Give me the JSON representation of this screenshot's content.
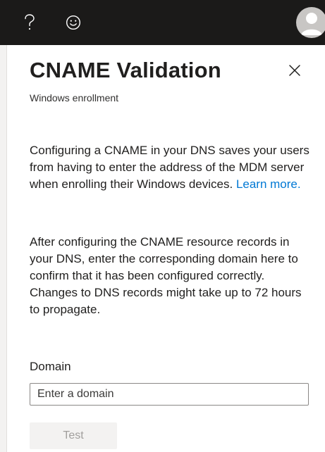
{
  "topbar": {
    "help_icon": "question-mark-icon",
    "feedback_icon": "smiley-face-icon",
    "avatar_icon": "user-avatar-icon"
  },
  "panel": {
    "title": "CNAME Validation",
    "subtitle": "Windows enrollment",
    "close_icon": "close-icon",
    "paragraph1_text": "Configuring a CNAME in your DNS saves your users from having to enter the address of the MDM server when enrolling their Windows devices.",
    "learn_more_link": "Learn more.",
    "paragraph2_text": "After configuring the CNAME resource records in your DNS, enter the corresponding domain here to confirm that it has been configured correctly. Changes to DNS records might take up to 72 hours to propagate.",
    "domain_label": "Domain",
    "domain_placeholder": "Enter a domain",
    "domain_value": "",
    "test_button_label": "Test"
  },
  "colors": {
    "topbar_bg": "#1b1a19",
    "link": "#0078d4",
    "disabled_button_bg": "#f3f2f1",
    "disabled_button_text": "#a19f9d"
  }
}
